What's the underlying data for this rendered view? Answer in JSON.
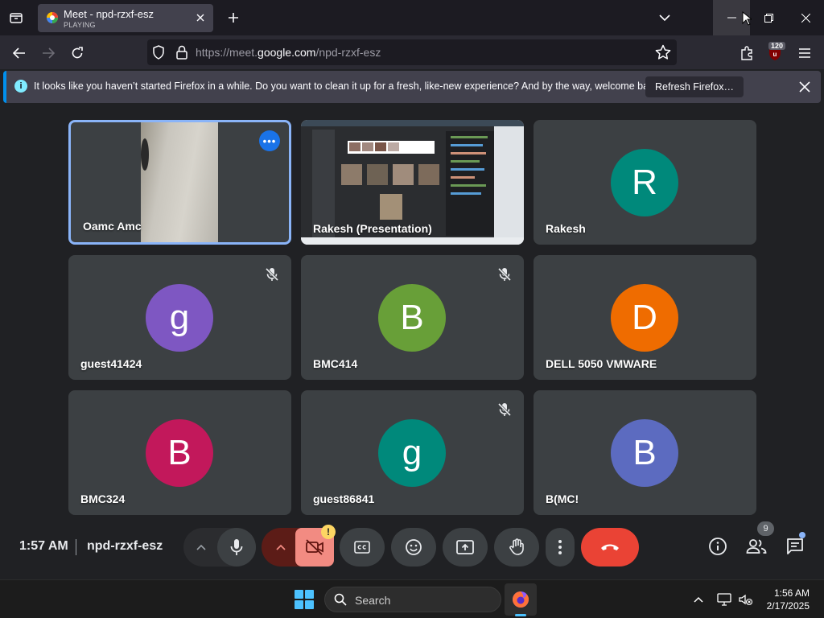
{
  "browser": {
    "tab": {
      "title": "Meet - npd-rzxf-esz",
      "subtitle": "PLAYING"
    },
    "url": {
      "prefix": "https://meet.",
      "domain": "google.com",
      "path": "/npd-rzxf-esz"
    },
    "extension_badge": "120",
    "notice": {
      "text": "It looks like you haven’t started Firefox in a while. Do you want to clean it up for a fresh, like-new experience? And by the way, welcome back!",
      "button": "Refresh Firefox…"
    }
  },
  "meet": {
    "participants": [
      {
        "name": "Oamc Amc",
        "type": "video"
      },
      {
        "name": "Rakesh (Presentation)",
        "type": "presentation"
      },
      {
        "name": "Rakesh",
        "initial": "R",
        "color": "#00897b",
        "muted": false
      },
      {
        "name": "guest41424",
        "initial": "g",
        "color": "#7e57c2",
        "muted": true
      },
      {
        "name": "BMC414",
        "initial": "B",
        "color": "#689f38",
        "muted": true
      },
      {
        "name": "DELL 5050 VMWARE",
        "initial": "D",
        "color": "#ef6c00",
        "muted": false
      },
      {
        "name": "BMC324",
        "initial": "B",
        "color": "#c2185b",
        "muted": false
      },
      {
        "name": "guest86841",
        "initial": "g",
        "color": "#00897b",
        "muted": true
      },
      {
        "name": "B(MC!",
        "initial": "B",
        "color": "#5c6bc0",
        "muted": false
      }
    ],
    "controls": {
      "time": "1:57 AM",
      "meeting_code": "npd-rzxf-esz",
      "people_count": "9",
      "warning": "!"
    }
  },
  "taskbar": {
    "search_label": "Search",
    "time": "1:56 AM",
    "date": "2/17/2025"
  },
  "colors": {
    "meet_bg": "#202124",
    "tile_bg": "#3c4043",
    "active_border": "#8ab4f8",
    "end_call": "#ea4335",
    "camera_off": "#f28b82"
  }
}
